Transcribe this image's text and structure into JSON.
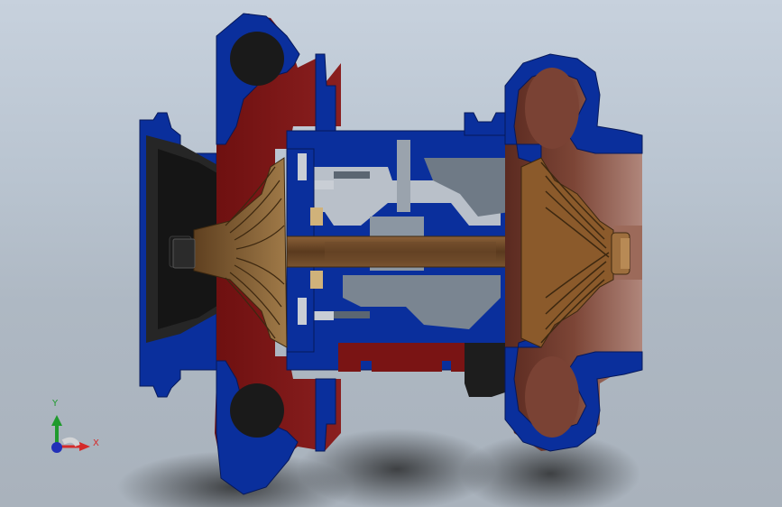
{
  "viewport": {
    "model": "turbocharger-section-view",
    "background_top": "#c7d1dd",
    "background_bottom": "#a9b2bc"
  },
  "colors": {
    "housing_cut": "#0a2f9c",
    "housing_outline": "#06185a",
    "compressor_housing": "#7a1414",
    "turbine_housing": "#6a2a22",
    "turbine_wheel": "#8b5a2b",
    "compressor_wheel": "#8c6a3f",
    "shaft": "#6e4a2a",
    "bearing": "#9aa3ad",
    "dark": "#232323"
  },
  "triad": {
    "y_label": "Y",
    "x_label": "X",
    "y_color": "#1f9a2d",
    "x_color": "#d52a2a",
    "z_color": "#2230b8"
  }
}
